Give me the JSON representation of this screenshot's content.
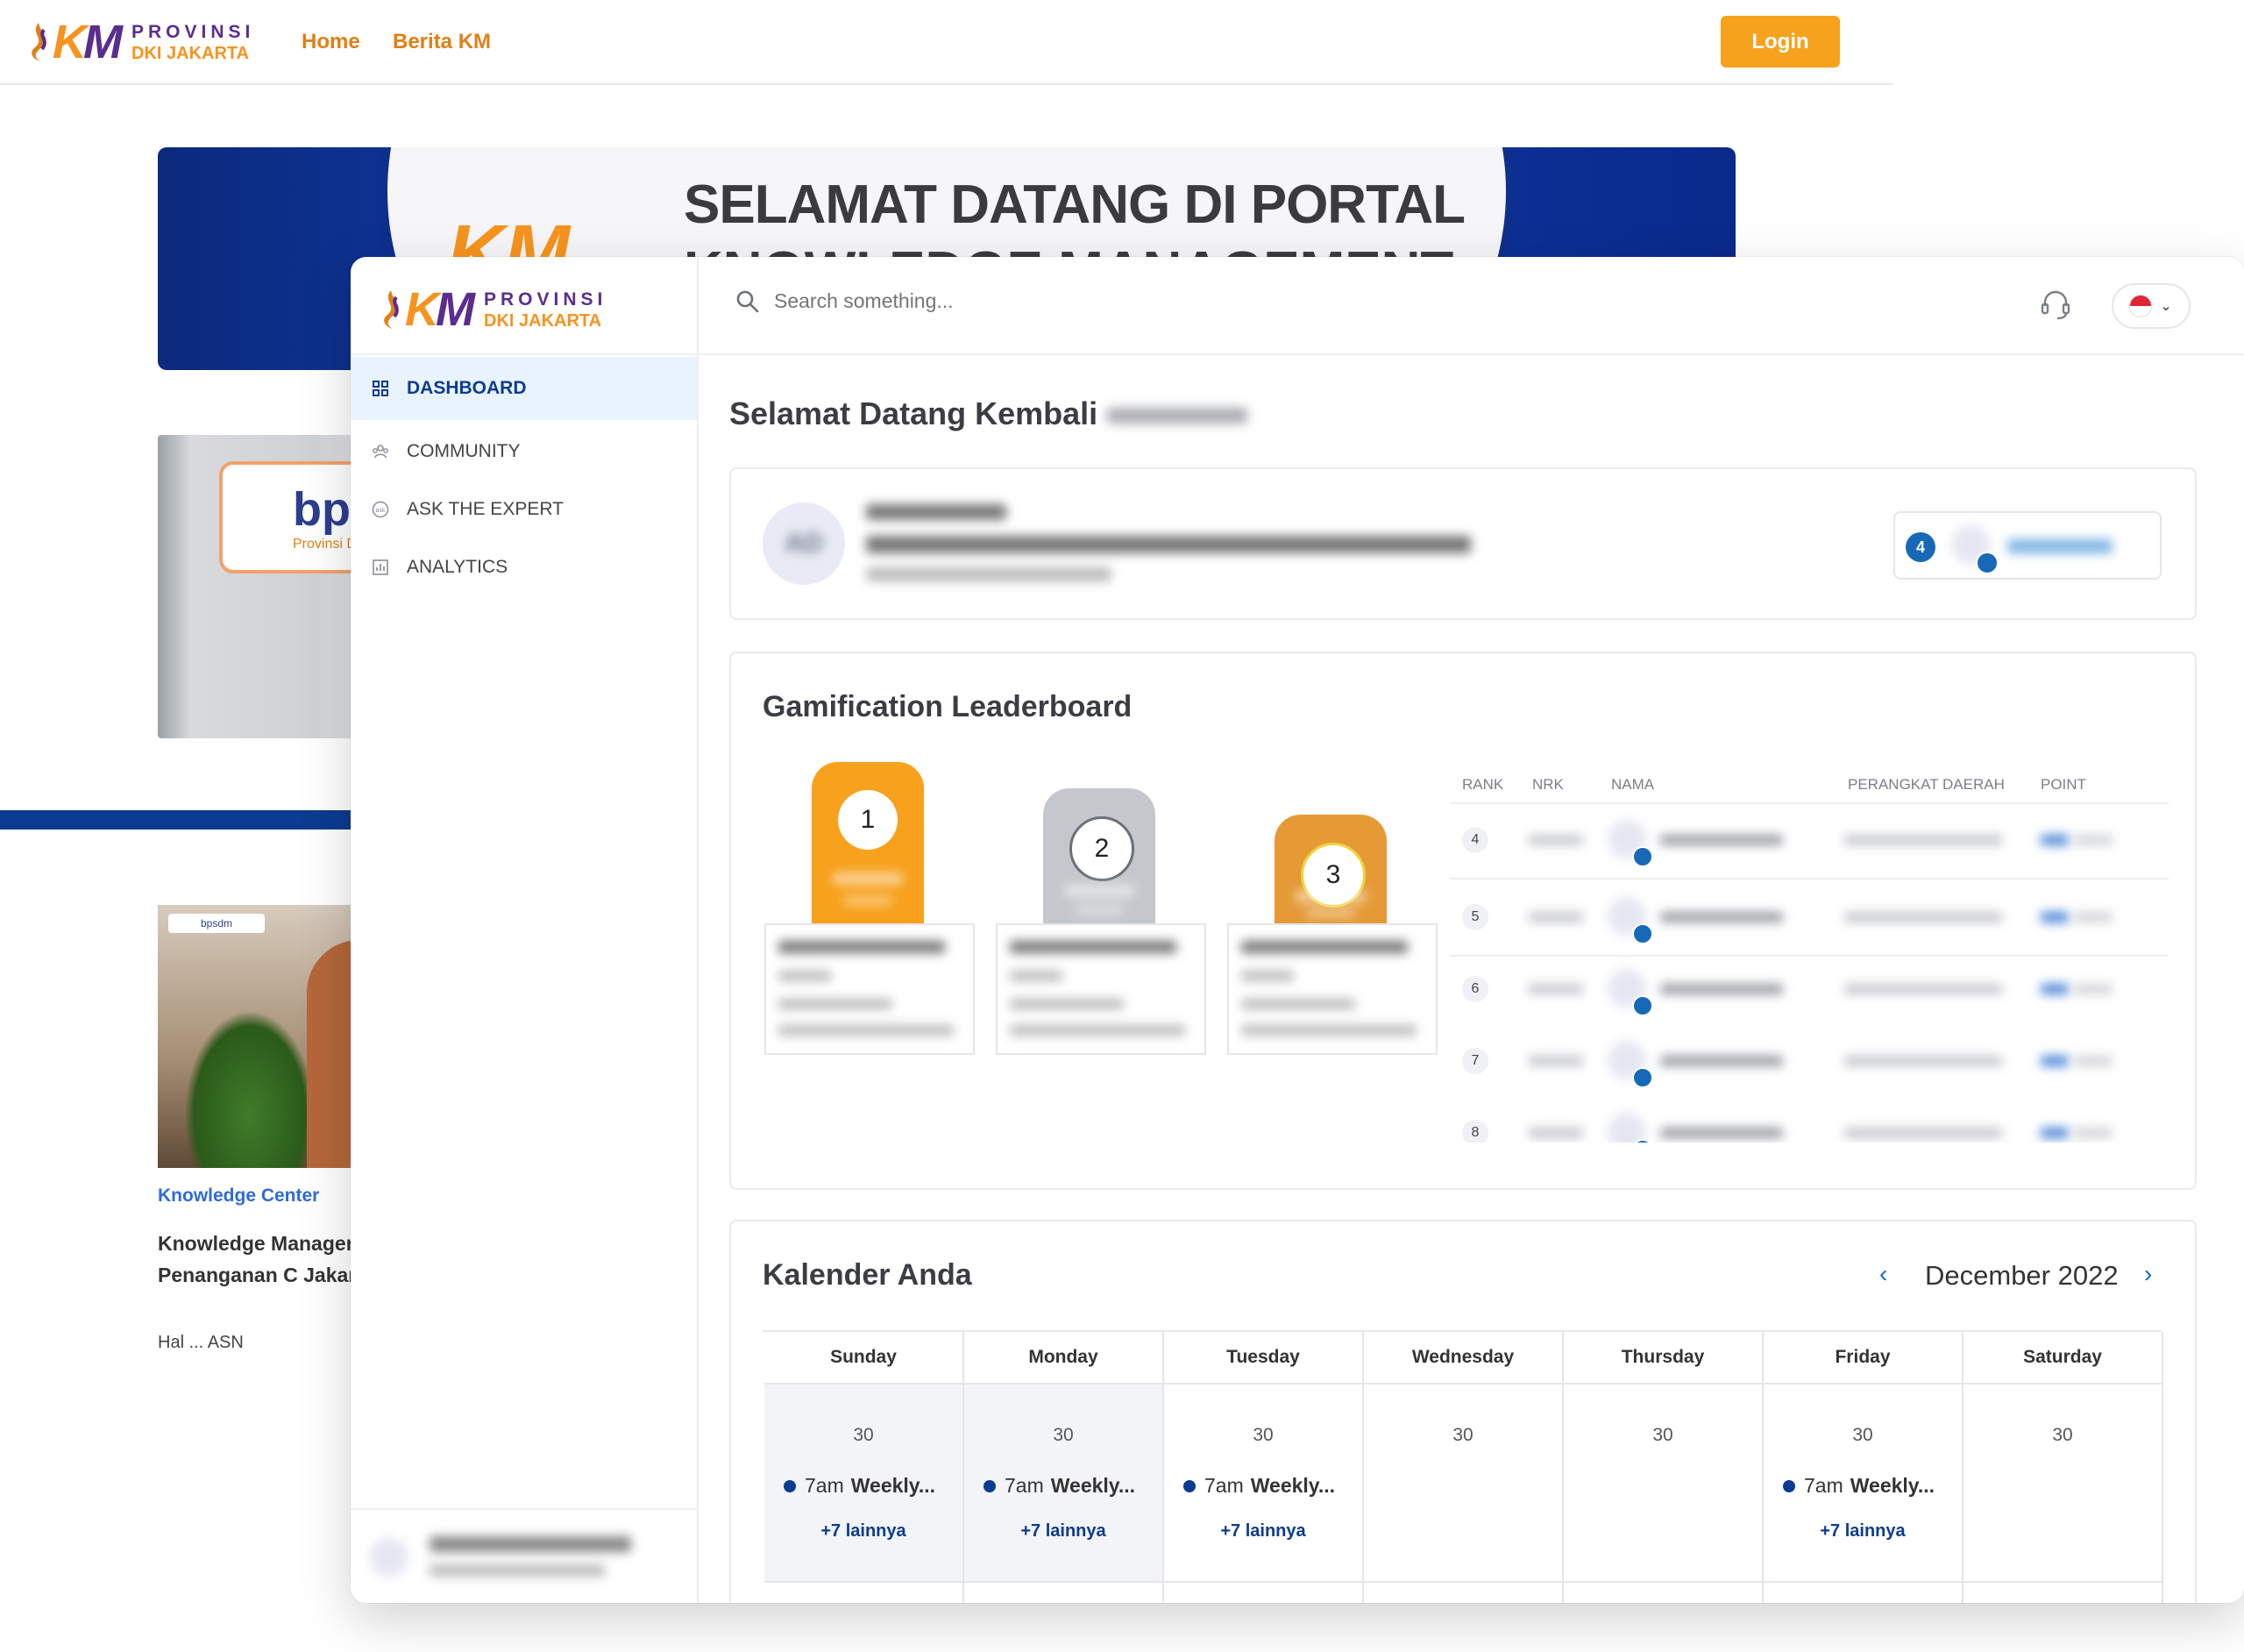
{
  "portal": {
    "logo_prov": "PROVINSI",
    "logo_dki": "DKI JAKARTA",
    "nav": [
      "Home",
      "Berita KM"
    ],
    "login": "Login",
    "hero_line1": "SELAMAT DATANG DI PORTAL",
    "hero_line2": "KNOWLEDGE MANAGEMENT",
    "sign_text": "bps",
    "sign_sub": "Provinsi D",
    "video_tag": "bpsdm",
    "card_label": "Knowledge Center",
    "card_title": "Knowledge Manager MKM. Penanganan C Jakarta)",
    "card_excerpt": "Hal ... ASN"
  },
  "app": {
    "logo_prov": "PROVINSI",
    "logo_dki": "DKI JAKARTA",
    "menu": [
      {
        "label": "DASHBOARD",
        "icon": "dashboard-icon",
        "active": true
      },
      {
        "label": "COMMUNITY",
        "icon": "community-icon",
        "active": false
      },
      {
        "label": "ASK THE EXPERT",
        "icon": "ask-icon",
        "active": false
      },
      {
        "label": "ANALYTICS",
        "icon": "analytics-icon",
        "active": false
      }
    ],
    "search_placeholder": "Search something...",
    "welcome": "Selamat Datang Kembali",
    "profile_initials": "AD",
    "user_rank": "4",
    "leaderboard": {
      "title": "Gamification Leaderboard",
      "podium": [
        "1",
        "2",
        "3"
      ],
      "columns": [
        "RANK",
        "NRK",
        "NAMA",
        "PERANGKAT DAERAH",
        "POINT"
      ],
      "rows": [
        "4",
        "5",
        "6",
        "7",
        "8"
      ]
    },
    "calendar": {
      "title": "Kalender Anda",
      "month": "December 2022",
      "prev": "‹",
      "next": "›",
      "days": [
        {
          "name": "Sunday",
          "date": "30",
          "event_time": "7am",
          "event_title": "Weekly...",
          "more": "+7 lainnya",
          "today": true
        },
        {
          "name": "Monday",
          "date": "30",
          "event_time": "7am",
          "event_title": "Weekly...",
          "more": "+7 lainnya",
          "today": true
        },
        {
          "name": "Tuesday",
          "date": "30",
          "event_time": "7am",
          "event_title": "Weekly...",
          "more": "+7 lainnya",
          "today": false
        },
        {
          "name": "Wednesday",
          "date": "30",
          "event_time": "",
          "event_title": "",
          "more": "",
          "today": false
        },
        {
          "name": "Thursday",
          "date": "30",
          "event_time": "",
          "event_title": "",
          "more": "",
          "today": false
        },
        {
          "name": "Friday",
          "date": "30",
          "event_time": "7am",
          "event_title": "Weekly...",
          "more": "+7 lainnya",
          "today": false
        },
        {
          "name": "Saturday",
          "date": "30",
          "event_time": "",
          "event_title": "",
          "more": "",
          "today": false
        }
      ]
    },
    "colors": {
      "primary": "#0c3b91",
      "accent": "#f6a21c",
      "gold": "#f7a11c",
      "silver": "#c4c7cc",
      "bronze": "#e59a36"
    }
  }
}
